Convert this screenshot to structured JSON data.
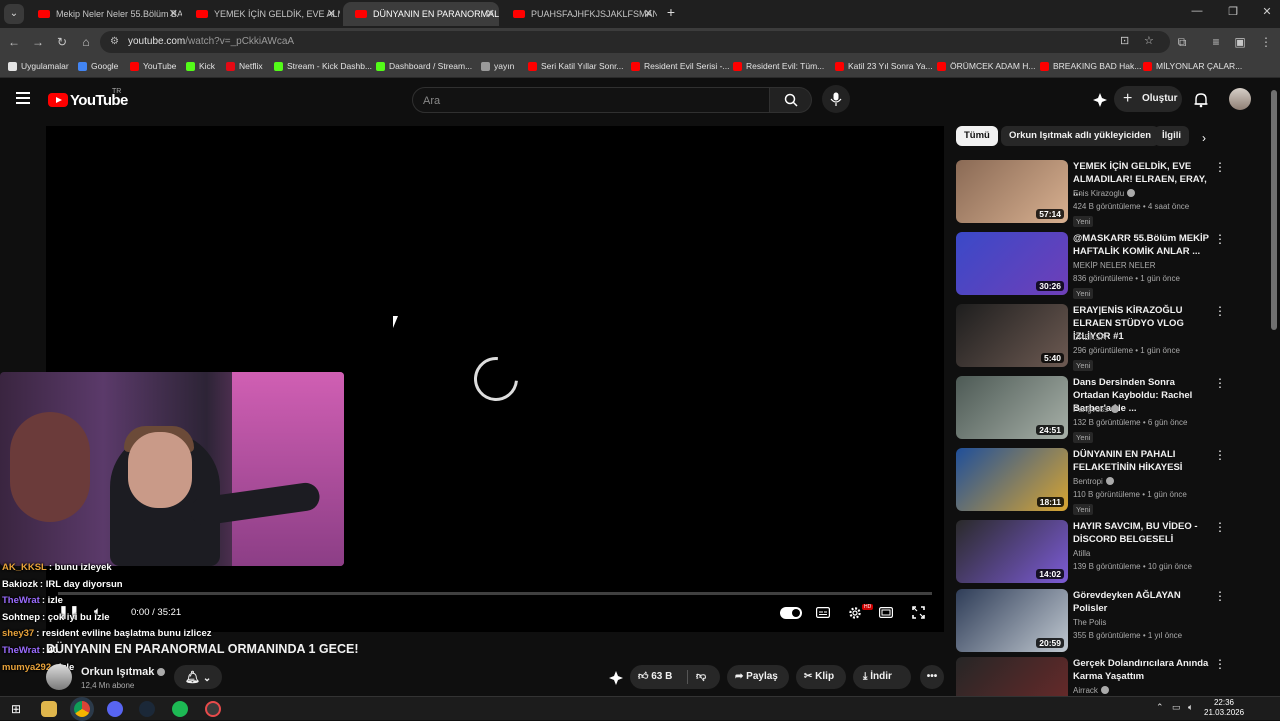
{
  "browser": {
    "tabs": [
      {
        "title": "Mekip Neler Neler 55.Bölüm BA",
        "active": false
      },
      {
        "title": "YEMEK İÇİN GELDİK, EVE ALMA",
        "active": false
      },
      {
        "title": "DÜNYANIN EN PARANORMAL",
        "active": true
      },
      {
        "title": "PUAHSFAJHFKJSJAKLFSMANZN",
        "active": false
      }
    ],
    "url_host": "youtube.com",
    "url_path": "/watch?v=_pCkkiAWcaA",
    "bookmarks": [
      {
        "label": "Uygulamalar",
        "color": "#e3e3e3"
      },
      {
        "label": "Google",
        "color": "#4285f4"
      },
      {
        "label": "YouTube",
        "color": "#ff0000"
      },
      {
        "label": "Kick",
        "color": "#53fc18"
      },
      {
        "label": "Netflix",
        "color": "#e50914"
      },
      {
        "label": "Stream - Kick Dashb...",
        "color": "#53fc18"
      },
      {
        "label": "Dashboard / Stream...",
        "color": "#53fc18"
      },
      {
        "label": "yayın",
        "color": "#9a9a9a"
      },
      {
        "label": "Seri Katil Yıllar Sonr...",
        "color": "#ff0000"
      },
      {
        "label": "Resident Evil Serisi -...",
        "color": "#ff0000"
      },
      {
        "label": "Resident Evil: Tüm...",
        "color": "#ff0000"
      },
      {
        "label": "Katil 23 Yıl Sonra Ya...",
        "color": "#ff0000"
      },
      {
        "label": "ÖRÜMCEK ADAM H...",
        "color": "#ff0000"
      },
      {
        "label": "BREAKING BAD Hak...",
        "color": "#ff0000"
      },
      {
        "label": "MİLYONLAR ÇALAR...",
        "color": "#ff0000"
      }
    ]
  },
  "youtube": {
    "logo_text": "YouTube",
    "region": "TR",
    "search_placeholder": "Ara",
    "create_label": "Oluştur"
  },
  "player": {
    "time": "0:00 / 35:21",
    "progress_fraction": 0.0
  },
  "chat": [
    {
      "user": "AK_KKSL",
      "text": ": bunu izleyek",
      "color": "#e8a23a"
    },
    {
      "user": "Bakiozk",
      "text": ": IRL day diyorsun",
      "color": "#ffffff"
    },
    {
      "user": "TheWrat",
      "text": ": izle",
      "color": "#9b6cff"
    },
    {
      "user": "Sohtnep",
      "text": ": çok iyi bu izle",
      "color": "#ffffff"
    },
    {
      "user": "shey37",
      "text": ": resident eviline başlatma bunu izlicez",
      "color": "#e8a23a"
    },
    {
      "user": "TheWrat",
      "text": ": 40",
      "color": "#9b6cff"
    },
    {
      "user": "mumya292",
      "text": ": izle",
      "color": "#e8a23a"
    }
  ],
  "video": {
    "title": "DÜNYANIN EN PARANORMAL ORMANINDA 1 GECE!",
    "channel": "Orkun Işıtmak",
    "subscribers": "12,4 Mn abone",
    "likes": "63 B",
    "share_label": "Paylaş",
    "clip_label": "Klip",
    "download_label": "İndir"
  },
  "chips": [
    "Tümü",
    "Orkun Işıtmak adlı yükleyiciden",
    "İlgili"
  ],
  "related": [
    {
      "title": "YEMEK İÇİN GELDİK, EVE ALMADILAR! ELRAEN, ERAY, ...",
      "channel": "Enis Kirazoglu",
      "verified": true,
      "views": "424 B görüntüleme",
      "age": "4 saat önce",
      "duration": "57:14",
      "new": "Yeni",
      "thumb": [
        "#8a6a55",
        "#d8b090"
      ]
    },
    {
      "title": "@MASKARR 55.Bölüm MEKİP HAFTALİK KOMİK ANLAR ...",
      "channel": "MEKİP NELER NELER",
      "verified": false,
      "views": "836 görüntüleme",
      "age": "1 gün önce",
      "duration": "30:26",
      "new": "Yeni",
      "thumb": [
        "#3a49c8",
        "#6f3fb8"
      ]
    },
    {
      "title": "ERAY|ENİS KİRAZOĞLU ELRAEN STÜDYO VLOG İZLİYOR #1",
      "channel": "DREKSA",
      "verified": false,
      "views": "296 görüntüleme",
      "age": "1 gün önce",
      "duration": "5:40",
      "new": "Yeni",
      "thumb": [
        "#1e1e1e",
        "#6d5a52"
      ]
    },
    {
      "title": "Dans Dersinden Sonra Ortadan Kayboldu: Rachel Barber'a Ne ...",
      "channel": "Pangvoss",
      "verified": true,
      "views": "132 B görüntüleme",
      "age": "6 gün önce",
      "duration": "24:51",
      "new": "Yeni",
      "thumb": [
        "#4d5a55",
        "#a7b0a8"
      ]
    },
    {
      "title": "DÜNYANIN EN PAHALI FELAKETİNİN HİKAYESİ",
      "channel": "Bentropi",
      "verified": true,
      "views": "110 B görüntüleme",
      "age": "1 gün önce",
      "duration": "18:11",
      "new": "Yeni",
      "thumb": [
        "#1f4f9a",
        "#d8a531"
      ]
    },
    {
      "title": "HAYIR SAVCIM, BU VİDEO - DİSCORD BELGESELİ",
      "channel": "Atilla",
      "verified": false,
      "views": "139 B görüntüleme",
      "age": "10 gün önce",
      "duration": "14:02",
      "new": "",
      "thumb": [
        "#2a2a2a",
        "#7c5bd6"
      ]
    },
    {
      "title": "Görevdeyken AĞLAYAN Polisler",
      "channel": "The Polis",
      "verified": false,
      "views": "355 B görüntüleme",
      "age": "1 yıl önce",
      "duration": "20:59",
      "new": "",
      "thumb": [
        "#2f3d58",
        "#c0c8d0"
      ]
    },
    {
      "title": "Gerçek Dolandırıcılara Anında Karma Yaşattım",
      "channel": "Airrack",
      "verified": true,
      "views": "",
      "age": "",
      "duration": "",
      "new": "",
      "thumb": [
        "#262626",
        "#6e2a2a"
      ]
    }
  ],
  "taskbar": {
    "time": "22:36",
    "date": "21.03.2026"
  }
}
